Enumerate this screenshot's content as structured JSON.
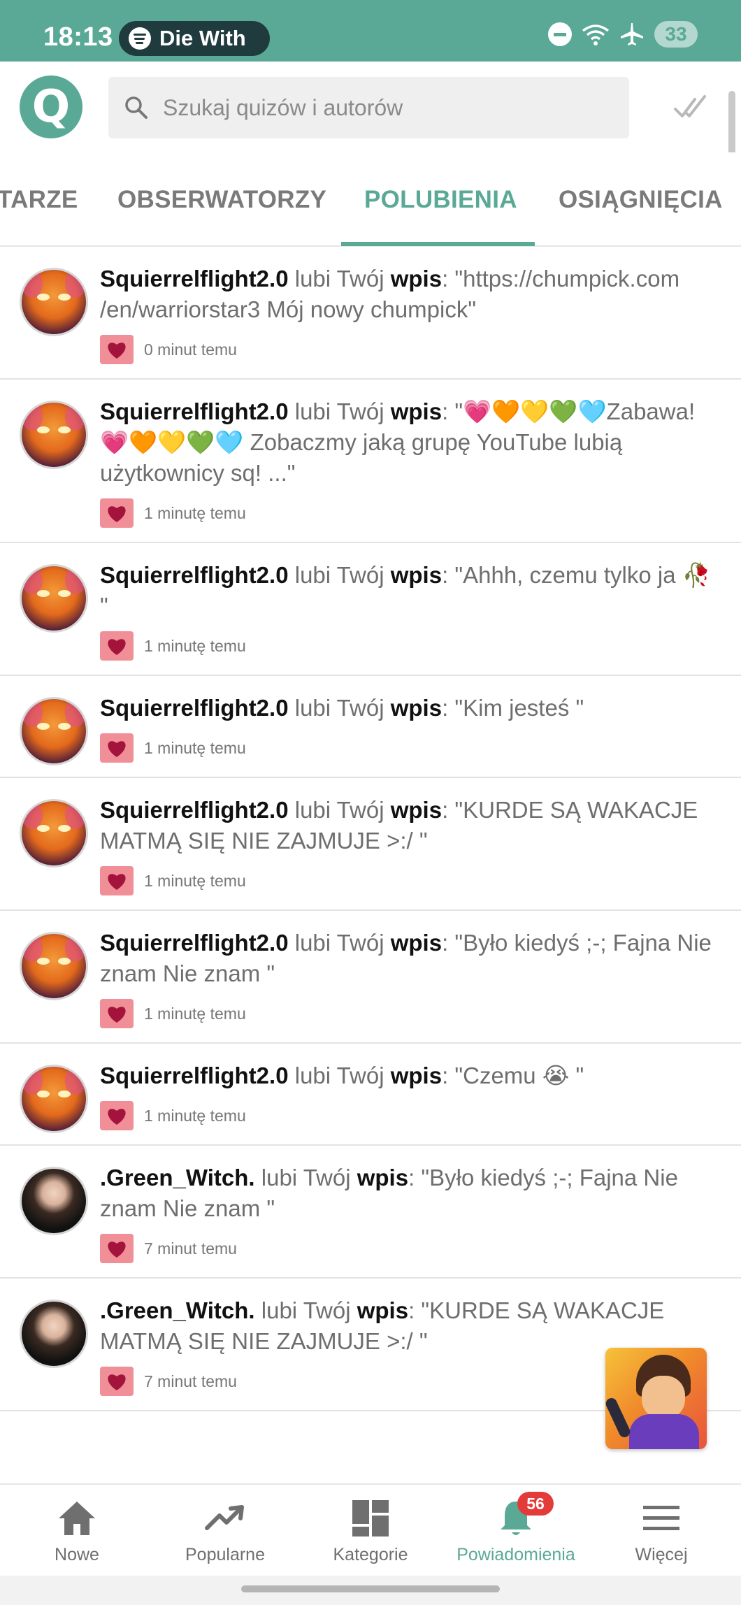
{
  "status_bar": {
    "time": "18:13",
    "media_text": "Die With",
    "battery": "33",
    "accent": "#5aa996"
  },
  "header": {
    "logo_letter": "Q",
    "search_placeholder": "Szukaj quizów i autorów"
  },
  "tabs": [
    {
      "label": "TARZE"
    },
    {
      "label": "OBSERWATORZY"
    },
    {
      "label": "POLUBIENIA",
      "active": true
    },
    {
      "label": "OSIĄGNIĘCIA"
    }
  ],
  "verb": " lubi Twój ",
  "keyword": "wpis",
  "notifications": [
    {
      "author": "Squierrelflight2.0",
      "quote": ": \"https://chumpick.com /en/warriorstar3 Mój nowy chumpick\"",
      "time": "0 minut temu",
      "avatar": "squirrel"
    },
    {
      "author": "Squierrelflight2.0",
      "quote": ": \"💗🧡💛💚🩵Zabawa! 💗🧡💛💚🩵 Zobaczmy jaką grupę YouTube lubią użytkownicy sq! ...\"",
      "time": "1 minutę temu",
      "avatar": "squirrel"
    },
    {
      "author": "Squierrelflight2.0",
      "quote": ": \"Ahhh, czemu tylko ja 🥀 \"",
      "time": "1 minutę temu",
      "avatar": "squirrel"
    },
    {
      "author": "Squierrelflight2.0",
      "quote": ": \"Kim jesteś \"",
      "time": "1 minutę temu",
      "avatar": "squirrel"
    },
    {
      "author": "Squierrelflight2.0",
      "quote": ": \"KURDE SĄ WAKACJE MATMĄ SIĘ NIE ZAJMUJE >:/ \"",
      "time": "1 minutę temu",
      "avatar": "squirrel"
    },
    {
      "author": "Squierrelflight2.0",
      "quote": ": \"Było kiedyś ;-; Fajna Nie znam Nie znam \"",
      "time": "1 minutę temu",
      "avatar": "squirrel"
    },
    {
      "author": "Squierrelflight2.0",
      "quote": ": \"Czemu 😭 \"",
      "time": "1 minutę temu",
      "avatar": "squirrel"
    },
    {
      "author": ".Green_Witch.",
      "quote": ": \"Było kiedyś ;-; Fajna Nie znam Nie znam \"",
      "time": "7 minut temu",
      "avatar": "witch"
    },
    {
      "author": ".Green_Witch.",
      "quote": ": \"KURDE SĄ WAKACJE MATMĄ SIĘ NIE ZAJMUJE >:/ \"",
      "time": "7 minut temu",
      "avatar": "witch"
    }
  ],
  "bottom_nav": [
    {
      "label": "Nowe",
      "icon": "home-icon"
    },
    {
      "label": "Popularne",
      "icon": "trending-icon"
    },
    {
      "label": "Kategorie",
      "icon": "categories-icon"
    },
    {
      "label": "Powiadomienia",
      "icon": "bell-icon",
      "active": true
    },
    {
      "label": "Więcej",
      "icon": "menu-icon"
    }
  ],
  "notification_badge": "56"
}
